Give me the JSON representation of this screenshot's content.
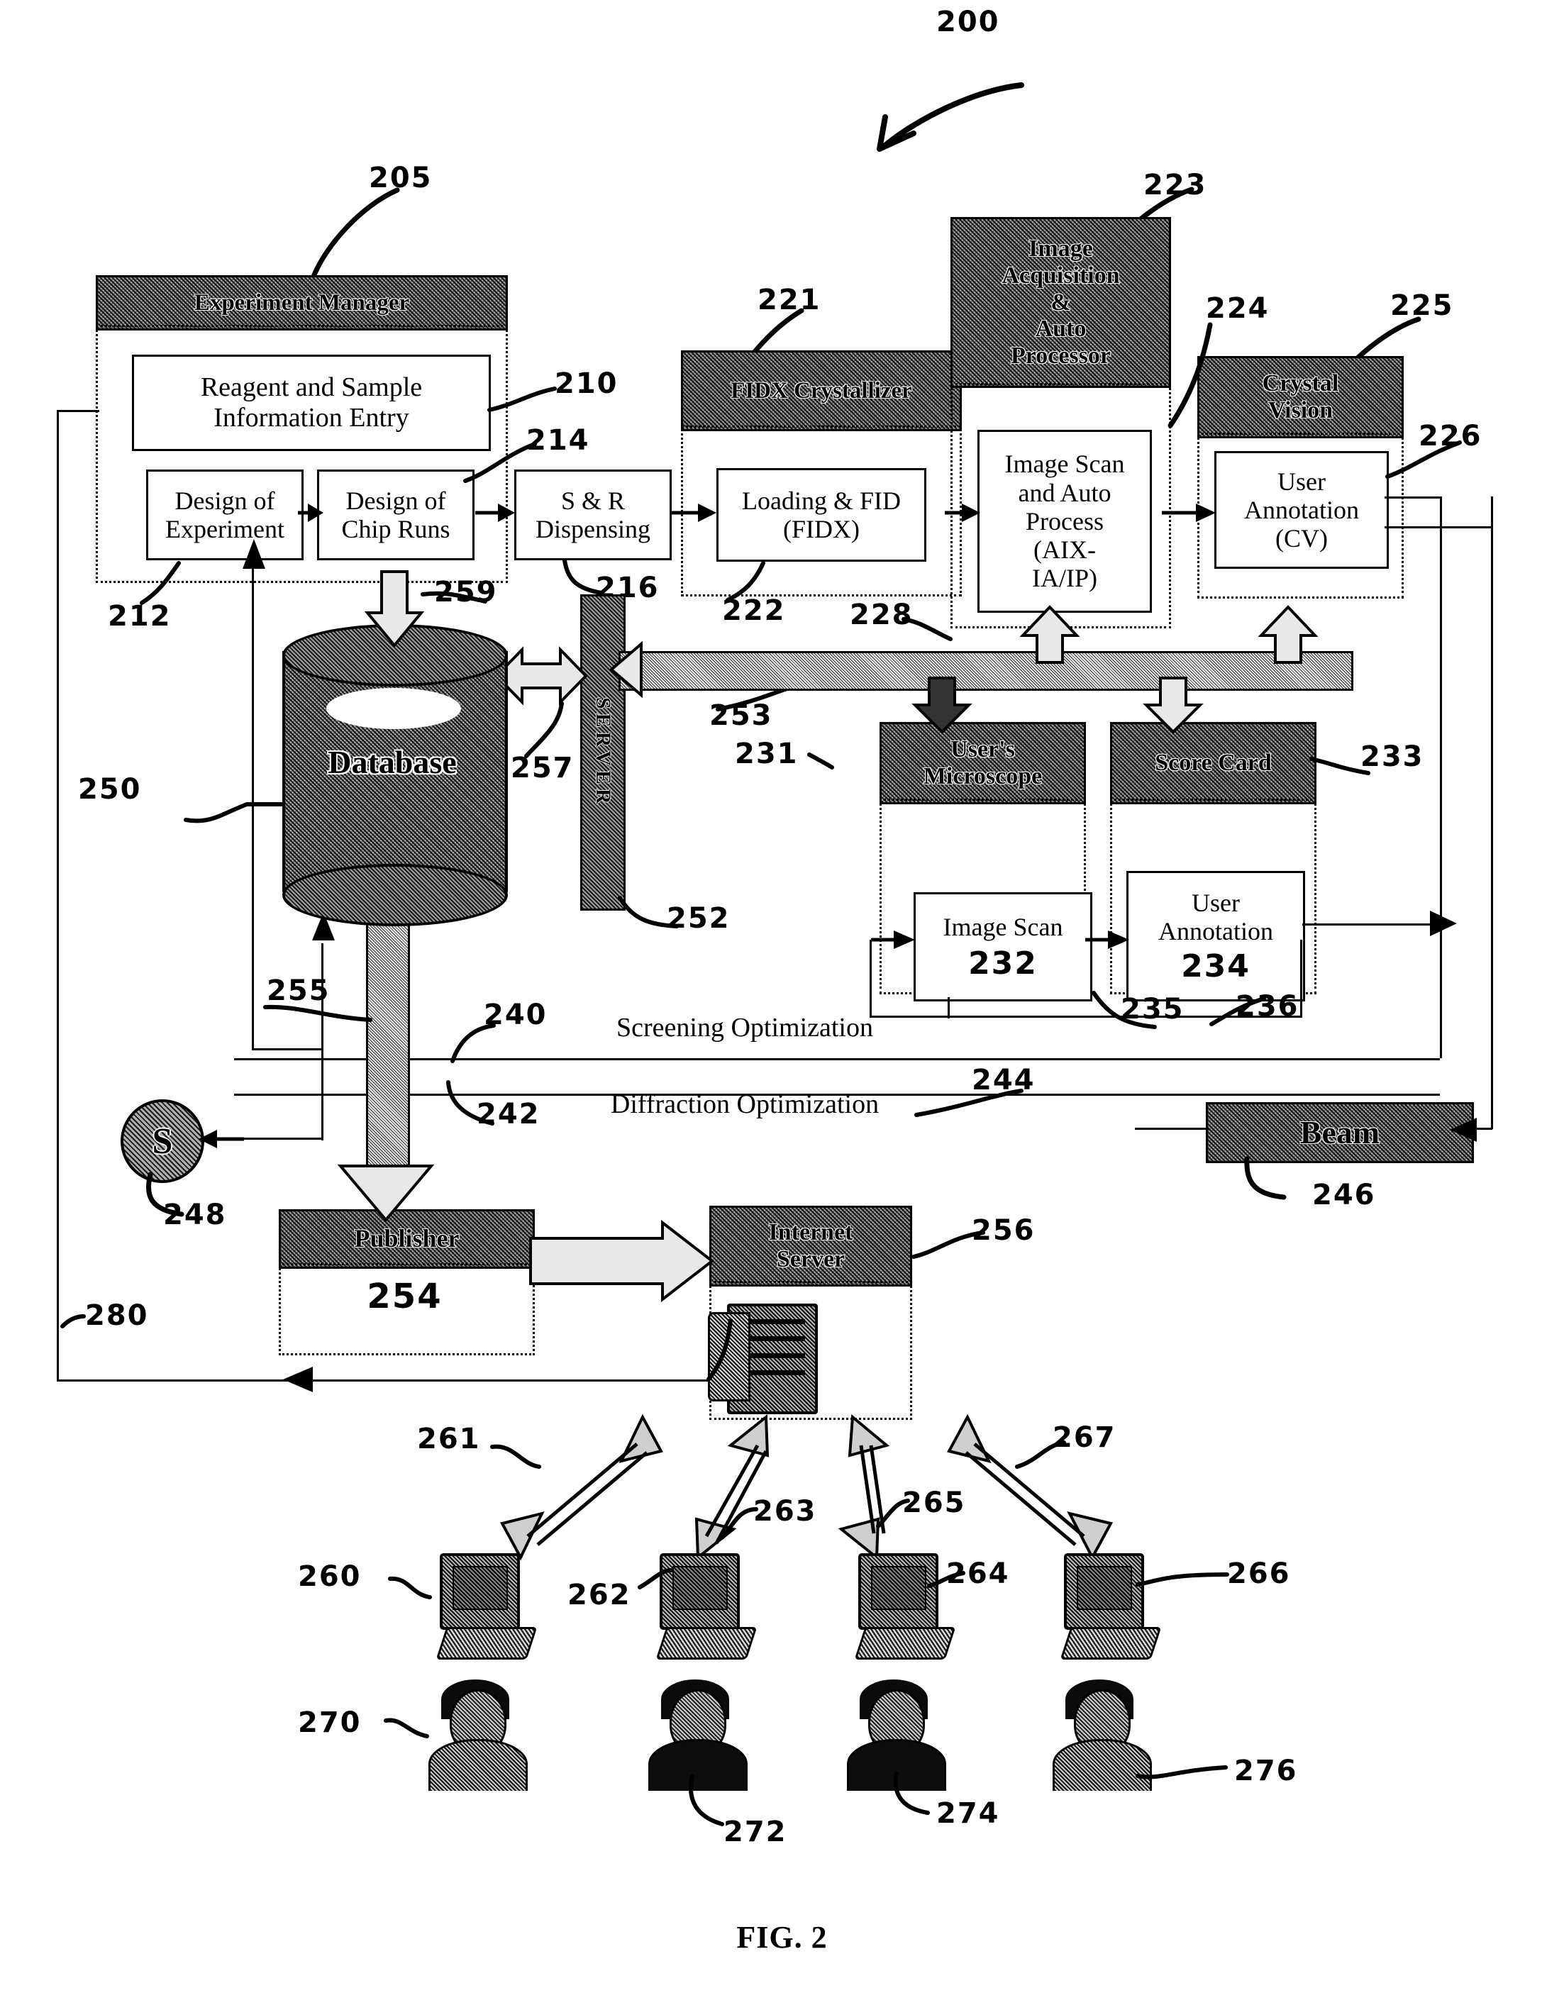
{
  "figure": {
    "caption": "FIG. 2",
    "system_ref": "200"
  },
  "modules": {
    "experiment_manager": {
      "title": "Experiment Manager",
      "ref": "205",
      "group_ref": "212",
      "children": [
        {
          "label": "Reagent and Sample Information Entry",
          "ref": "210"
        },
        {
          "label": "Design of Experiment",
          "ref": ""
        },
        {
          "label": "Design of Chip Runs",
          "ref": "214"
        },
        {
          "label": "S & R Dispensing",
          "ref": "216"
        }
      ]
    },
    "fidx_crystallizer": {
      "title": "FIDX Crystallizer",
      "ref": "221",
      "group_ref": "222",
      "children": [
        {
          "label": "Loading & FID (FIDX)",
          "ref": ""
        }
      ]
    },
    "image_acquisition": {
      "title": "Image Acquisition & Auto Processor",
      "title_lines": [
        "Image",
        "Acquisition",
        "&",
        "Auto",
        "Processor"
      ],
      "ref": "223",
      "children": [
        {
          "label": "Image Scan and Auto Process (AIX-IA/IP)",
          "ref": "228"
        }
      ]
    },
    "crystal_vision": {
      "title": "Crystal Vision",
      "title_lines": [
        "Crystal",
        "Vision"
      ],
      "ref": "225",
      "pointer_ref": "224",
      "children": [
        {
          "label": "User Annotation (CV)",
          "ref": "226"
        }
      ]
    },
    "users_microscope": {
      "title": "User's Microscope",
      "title_lines": [
        "User's",
        "Microscope"
      ],
      "ref": "231",
      "group_ref": "235",
      "children": [
        {
          "label": "Image Scan",
          "ref": "232"
        }
      ]
    },
    "score_card": {
      "title": "Score Card",
      "ref": "233",
      "group_ref": "236",
      "children": [
        {
          "label": "User Annotation",
          "ref": "234"
        }
      ]
    },
    "database": {
      "label": "Database",
      "ref": "250",
      "inflow_ref": "259"
    },
    "server": {
      "label": "SERVER",
      "ref": "252",
      "link_ref": "257",
      "bus_ref": "253"
    },
    "publisher": {
      "title": "Publisher",
      "ref": "254",
      "feed_ref": "255"
    },
    "internet_server": {
      "title": "Internet Server",
      "title_lines": [
        "Internet",
        "Server"
      ],
      "ref": "256"
    },
    "beam": {
      "title": "Beam",
      "ref": "246",
      "link_ref": "244"
    },
    "sample_node": {
      "label": "S",
      "ref": "248"
    }
  },
  "bus_labels": {
    "screening": {
      "label": "Screening Optimization",
      "ref": "240"
    },
    "diffraction": {
      "label": "Diffraction Optimization",
      "ref": "242"
    },
    "feedback_loop_ref": "280"
  },
  "clients": [
    {
      "computer_ref": "260",
      "link_ref": "261",
      "person_ref": "270"
    },
    {
      "computer_ref": "262",
      "link_ref": "263",
      "person_ref": "272"
    },
    {
      "computer_ref": "264",
      "link_ref": "265",
      "person_ref": "274"
    },
    {
      "computer_ref": "266",
      "link_ref": "267",
      "person_ref": "276"
    }
  ],
  "inner_box_text": {
    "image_scan_auto_l1": "Image Scan",
    "image_scan_auto_l2": "and Auto",
    "image_scan_auto_l3": "Process",
    "image_scan_auto_l4": "(AIX-",
    "image_scan_auto_l5": "IA/IP)",
    "user_annotation_cv_l1": "User",
    "user_annotation_cv_l2": "Annotation",
    "user_annotation_cv_l3": "(CV)",
    "loading_fid_l1": "Loading & FID",
    "loading_fid_l2": "(FIDX)",
    "sr_dispensing_l1": "S & R",
    "sr_dispensing_l2": "Dispensing",
    "design_exp_l1": "Design of",
    "design_exp_l2": "Experiment",
    "design_chip_l1": "Design of",
    "design_chip_l2": "Chip Runs",
    "reagent_l1": "Reagent and Sample",
    "reagent_l2": "Information Entry",
    "image_scan_micro": "Image Scan",
    "user_annotation_sc_l1": "User",
    "user_annotation_sc_l2": "Annotation"
  }
}
